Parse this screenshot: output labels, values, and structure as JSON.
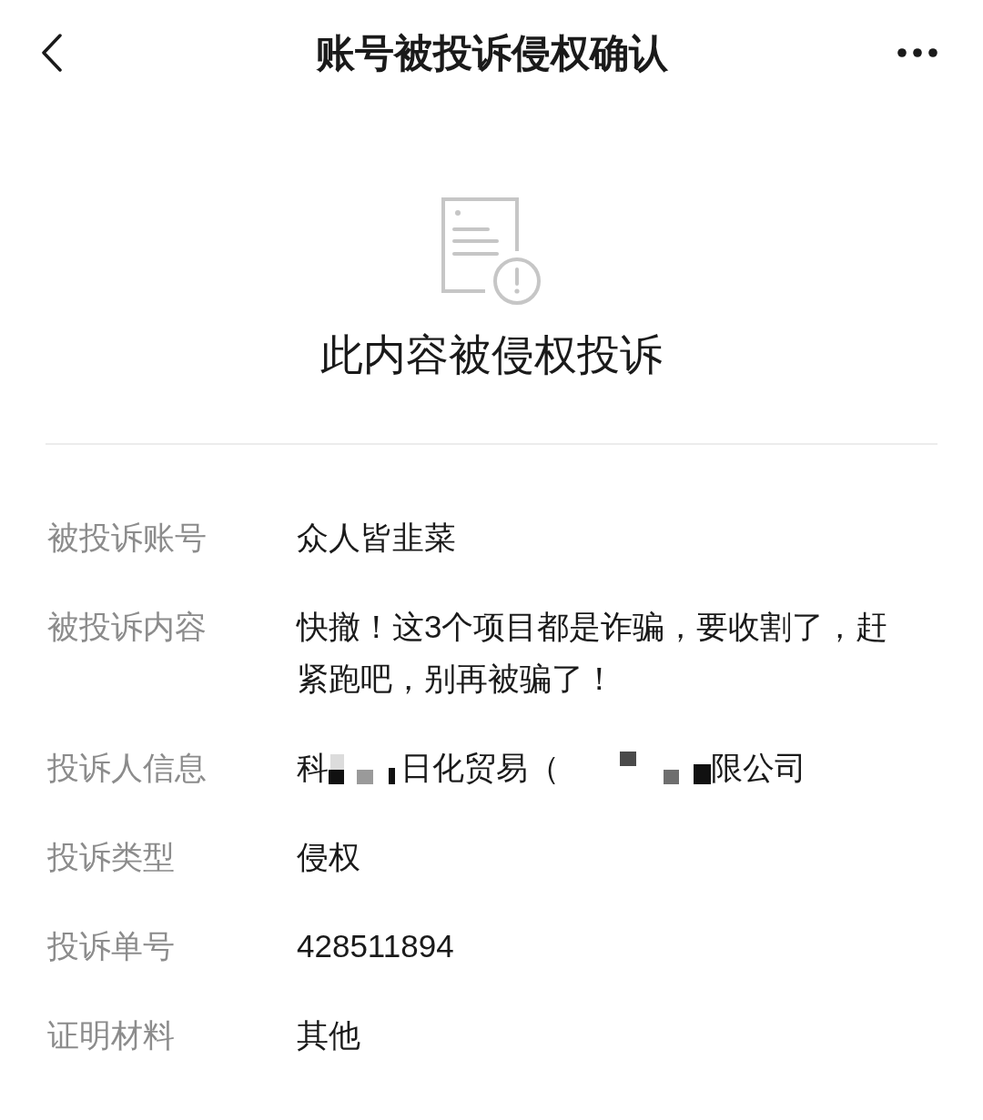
{
  "nav": {
    "title": "账号被投诉侵权确认"
  },
  "notice": {
    "heading": "此内容被侵权投诉"
  },
  "details": [
    {
      "kind": "plain",
      "label": "被投诉账号",
      "value": "众人皆韭菜"
    },
    {
      "kind": "plain",
      "label": "被投诉内容",
      "value": "快撤！这3个项目都是诈骗，要收割了，赶紧跑吧，别再被骗了！"
    },
    {
      "kind": "redacted",
      "label": "投诉人信息",
      "parts": [
        {
          "kind": "text",
          "text": "科"
        },
        {
          "kind": "redaction"
        },
        {
          "kind": "text",
          "text": "日化贸易（"
        },
        {
          "kind": "redaction"
        },
        {
          "kind": "text",
          "text": "限公司"
        }
      ]
    },
    {
      "kind": "plain",
      "label": "投诉类型",
      "value": "侵权"
    },
    {
      "kind": "plain",
      "label": "投诉单号",
      "value": "428511894"
    },
    {
      "kind": "plain",
      "label": "证明材料",
      "value": "其他"
    }
  ]
}
